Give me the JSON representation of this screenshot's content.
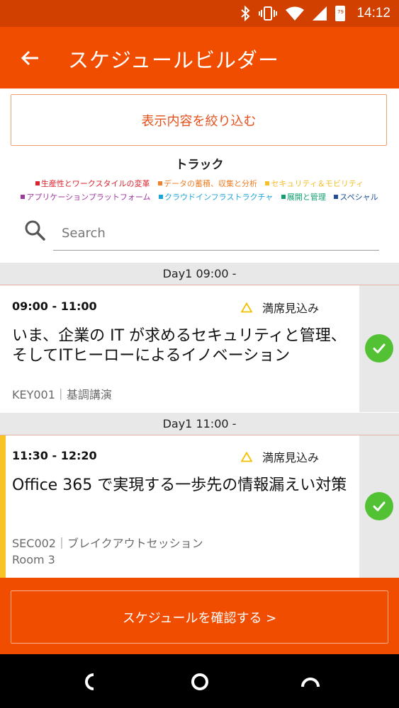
{
  "status_bar": {
    "time": "14:12",
    "battery_level": "79"
  },
  "app_bar": {
    "title": "スケジュールビルダー"
  },
  "filter_button": {
    "label": "表示内容を絞り込む"
  },
  "track": {
    "title": "トラック",
    "rows": [
      [
        {
          "label": "生産性とワークスタイルの変革",
          "color": "#d9232d"
        },
        {
          "label": "データの蓄積、収集と分析",
          "color": "#f0802a"
        },
        {
          "label": "セキュリティ＆モビリティ",
          "color": "#f5c028"
        }
      ],
      [
        {
          "label": "アプリケーションプラットフォーム",
          "color": "#9e3a9e"
        },
        {
          "label": "クラウドインフラストラクチャ",
          "color": "#1ea5d8"
        },
        {
          "label": "展開と管理",
          "color": "#12a070"
        },
        {
          "label": "スペシャル",
          "color": "#1f4f9a"
        }
      ]
    ]
  },
  "search": {
    "placeholder": "Search"
  },
  "sections": [
    {
      "header": "Day1 09:00 -",
      "session": {
        "time": "09:00 - 11:00",
        "availability": "満席見込み",
        "title": "いま、企業の IT が求めるセキュリティと管理、そしてITヒーローによるイノベーション",
        "code_type": "KEY001｜基調講演",
        "room": ""
      }
    },
    {
      "header": "Day1 11:00 -",
      "session": {
        "time": "11:30 - 12:20",
        "availability": "満席見込み",
        "title": "Office 365  で実現する一歩先の情報漏えい対策",
        "code_type": "SEC002｜ブレイクアウトセッション",
        "room": "Room 3",
        "accent_color": "#f7c325"
      }
    }
  ],
  "confirm_button": {
    "label": "スケジュールを確認する >"
  }
}
